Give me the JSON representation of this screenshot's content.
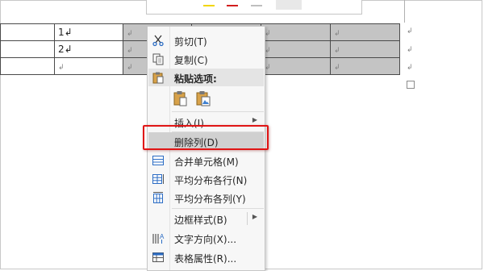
{
  "colors": {
    "selected_cell": "#c4c4c4",
    "menu_bg": "#f7f7f7",
    "menu_highlight": "#d0d0d0",
    "highlight_box": "#e01515"
  },
  "table": {
    "rows": [
      [
        "",
        "1↲",
        "↲",
        "↲",
        "↲",
        "↲"
      ],
      [
        "",
        "2↲",
        "↲",
        "↲",
        "↲",
        "↲"
      ],
      [
        "",
        "↲",
        "↲",
        "↲",
        "↲",
        "↲"
      ]
    ],
    "row_end_mark": "↲"
  },
  "menu": {
    "cut": {
      "label": "剪切(T)",
      "icon": "scissors-icon"
    },
    "copy": {
      "label": "复制(C)",
      "icon": "copy-icon"
    },
    "paste_options": {
      "label": "粘贴选项:",
      "icon": "clipboard-icon",
      "options": [
        "paste-keep-format-icon",
        "paste-image-icon"
      ]
    },
    "insert": {
      "label": "插入(I)",
      "submenu": true
    },
    "delete_column": {
      "label": "删除列(D)",
      "highlighted": true
    },
    "merge_cells": {
      "label": "合并单元格(M)",
      "icon": "merge-cells-icon"
    },
    "distribute_rows": {
      "label": "平均分布各行(N)",
      "icon": "distribute-rows-icon"
    },
    "distribute_columns": {
      "label": "平均分布各列(Y)",
      "icon": "distribute-columns-icon"
    },
    "border_styles": {
      "label": "边框样式(B)",
      "submenu": true
    },
    "text_direction": {
      "label": "文字方向(X)...",
      "icon": "text-direction-icon"
    },
    "table_properties": {
      "label": "表格属性(R)...",
      "icon": "table-properties-icon"
    }
  }
}
